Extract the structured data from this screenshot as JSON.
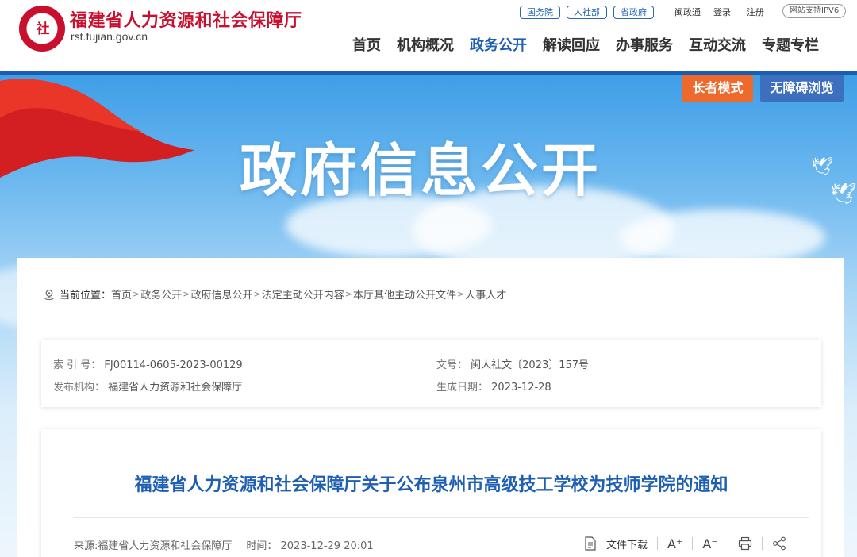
{
  "header": {
    "site_name": "福建省人力资源和社会保障厅",
    "site_url": "rst.fujian.gov.cn",
    "logo_char": "社",
    "top_pills": [
      "国务院",
      "人社部",
      "省政府"
    ],
    "top_links": [
      "闽政通",
      "登录",
      "注册"
    ],
    "ipv6_label": "网站支持IPV6",
    "nav": [
      "首页",
      "机构概况",
      "政务公开",
      "解读回应",
      "办事服务",
      "互动交流",
      "专题专栏"
    ],
    "active_nav": "政务公开"
  },
  "banner": {
    "title": "政府信息公开",
    "elder_mode": "长者模式",
    "accessible": "无障碍浏览"
  },
  "breadcrumb": {
    "label": "当前位置：",
    "items": [
      "首页",
      "政务公开",
      "政府信息公开",
      "法定主动公开内容",
      "本厅其他主动公开文件",
      "人事人才"
    ],
    "separator": ">"
  },
  "meta": {
    "index_label": "索 引 号：",
    "index_value": "FJ00114-0605-2023-00129",
    "doc_label": "文号：",
    "doc_value": "闽人社文〔2023〕157号",
    "publisher_label": "发布机构：",
    "publisher_value": "福建省人力资源和社会保障厅",
    "date_label": "生成日期：",
    "date_value": "2023-12-28"
  },
  "article": {
    "title": "福建省人力资源和社会保障厅关于公布泉州市高级技工学校为技师学院的通知",
    "source": "来源:福建省人力资源和社会保障厅",
    "time": "时间： 2023-12-29 20:01",
    "download_label": "文件下载",
    "font_up": "A⁺",
    "font_down": "A⁻"
  },
  "colors": {
    "brand_red": "#c8102e",
    "brand_blue": "#1f5fb3",
    "elder_orange": "#ee6a2c",
    "access_blue": "#3d6fbf"
  }
}
